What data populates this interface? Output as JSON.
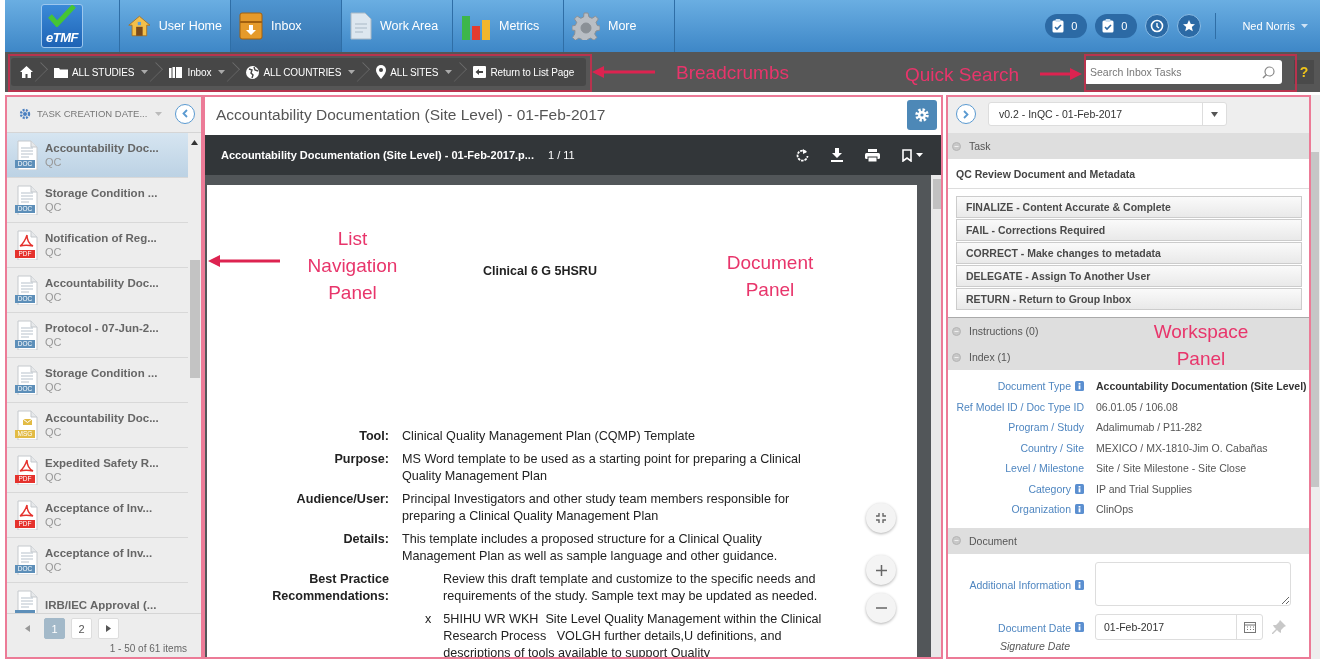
{
  "top_nav": {
    "logo_text": "eTMF",
    "tabs": [
      {
        "label": "User Home",
        "selected": false
      },
      {
        "label": "Inbox",
        "selected": true
      },
      {
        "label": "Work Area",
        "selected": false
      },
      {
        "label": "Metrics",
        "selected": false
      },
      {
        "label": "More",
        "selected": false
      }
    ],
    "badges": [
      {
        "count": "0"
      },
      {
        "count": "0"
      }
    ],
    "user": "Ned Norris"
  },
  "breadcrumbs": [
    {
      "kind": "home",
      "dropdown": false
    },
    {
      "kind": "item",
      "label": "ALL STUDIES",
      "dropdown": true
    },
    {
      "kind": "item",
      "label": "Inbox",
      "dropdown": true
    },
    {
      "kind": "item",
      "label": "ALL COUNTRIES",
      "dropdown": true
    },
    {
      "kind": "item",
      "label": "ALL SITES",
      "dropdown": true
    },
    {
      "kind": "item",
      "label": "Return to List Page",
      "dropdown": false
    }
  ],
  "quick_search": {
    "placeholder": "Search Inbox Tasks"
  },
  "help_button": "?",
  "list_panel": {
    "sort_label": "TASK CREATION DATE...",
    "items": [
      {
        "title": "Accountability Doc...",
        "subtitle": "QC",
        "kind": "doc",
        "file_type": "DOC",
        "selected": true
      },
      {
        "title": "Storage Condition ...",
        "subtitle": "QC",
        "kind": "doc",
        "file_type": "DOC",
        "selected": false
      },
      {
        "title": "Notification of Reg...",
        "subtitle": "QC",
        "kind": "pdf",
        "file_type": "PDF",
        "selected": false
      },
      {
        "title": "Accountability Doc...",
        "subtitle": "QC",
        "kind": "doc",
        "file_type": "DOC",
        "selected": false
      },
      {
        "title": "Protocol - 07-Jun-2...",
        "subtitle": "QC",
        "kind": "doc",
        "file_type": "DOC",
        "selected": false
      },
      {
        "title": "Storage Condition ...",
        "subtitle": "QC",
        "kind": "doc",
        "file_type": "DOC",
        "selected": false
      },
      {
        "title": "Accountability Doc...",
        "subtitle": "QC",
        "kind": "msg",
        "file_type": "MSG",
        "selected": false
      },
      {
        "title": "Expedited Safety R...",
        "subtitle": "QC",
        "kind": "pdf",
        "file_type": "PDF",
        "selected": false
      },
      {
        "title": "Acceptance of Inv...",
        "subtitle": "QC",
        "kind": "pdf",
        "file_type": "PDF",
        "selected": false
      },
      {
        "title": "Acceptance of Inv...",
        "subtitle": "QC",
        "kind": "doc",
        "file_type": "DOC",
        "selected": false
      },
      {
        "title": "IRB/IEC Approval (...",
        "kind": "doc",
        "selected": false
      }
    ],
    "pages": [
      {
        "label": "1",
        "selected": true
      },
      {
        "label": "2",
        "selected": false
      }
    ],
    "summary": "1 - 50 of 61 items"
  },
  "document_panel": {
    "title": "Accountability Documentation (Site Level) - 01-Feb-2017",
    "viewer": {
      "file_name": "Accountability Documentation (Site Level) - 01-Feb-2017.p...",
      "page_indicator": "1 / 11"
    },
    "page": {
      "heading": "Clinical 6 G 5HSRU",
      "fields": [
        {
          "kind": "plain",
          "label": "Tool:",
          "value": "Clinical Quality Management Plan (CQMP) Template"
        },
        {
          "kind": "plain",
          "label": "Purpose:",
          "value": "MS Word template to be used as a starting point for preparing a Clinical Quality Management Plan"
        },
        {
          "kind": "plain",
          "label": "Audience/User:",
          "value": "Principal Investigators and other study team members responsible for preparing a Clinical Quality Management Plan"
        },
        {
          "kind": "plain",
          "label": "Details:",
          "value": "This template includes a proposed structure for a Clinical Quality Management Plan as well as sample language and other guidance."
        },
        {
          "kind": "indented",
          "label": "Best Practice Recommendations:",
          "value": "Review this draft template and customize to the specific needs and requirements of the study.  Sample text may be updated as needed."
        }
      ],
      "bullet": {
        "mark": "x",
        "text": "5HIHU WR WKH  Site Level Quality Management within the Clinical Research Process   VOLGH further details,U definitions, and descriptions of tools available to support Quality"
      }
    }
  },
  "workspace_panel": {
    "version": "v0.2 - InQC - 01-Feb-2017",
    "task_section": {
      "title": "Task",
      "task_name": "QC Review Document and Metadata",
      "actions": [
        "FINALIZE - Content Accurate & Complete",
        "FAIL - Corrections Required",
        "CORRECT - Make changes to metadata",
        "DELEGATE - Assign To Another User",
        "RETURN - Return to Group Inbox"
      ]
    },
    "instructions_section": {
      "title": "Instructions (0)"
    },
    "index_section": {
      "title": "Index (1)",
      "rows": [
        {
          "label": "Document Type",
          "info": true,
          "value": "Accountability Documentation (Site Level)",
          "bold": true
        },
        {
          "label": "Ref Model ID / Doc Type ID",
          "info": false,
          "value": "06.01.05 / 106.08",
          "bold": false
        },
        {
          "label": "Program / Study",
          "info": false,
          "value": "Adalimumab / P11-282",
          "bold": false
        },
        {
          "label": "Country / Site",
          "info": false,
          "value": "MEXICO / MX-1810-Jim O. Cabañas",
          "bold": false
        },
        {
          "label": "Level / Milestone",
          "info": false,
          "value": "Site / Site Milestone - Site Close",
          "bold": false
        },
        {
          "label": "Category",
          "info": true,
          "value": "IP and Trial Supplies",
          "bold": false
        },
        {
          "label": "Organization",
          "info": true,
          "value": "ClinOps",
          "bold": false
        }
      ]
    },
    "document_section": {
      "title": "Document",
      "fields": [
        {
          "kind": "textarea",
          "label": "Additional Information",
          "info": true
        },
        {
          "kind": "date",
          "label": "Document Date",
          "info": true,
          "value": "01-Feb-2017",
          "note": "Signature Date"
        }
      ]
    }
  },
  "annotations": [
    {
      "text": "Breadcrumbs"
    },
    {
      "text": "Quick Search"
    },
    {
      "text": "List Navigation Panel"
    },
    {
      "text": "Document Panel"
    },
    {
      "text": "Workspace Panel"
    }
  ]
}
